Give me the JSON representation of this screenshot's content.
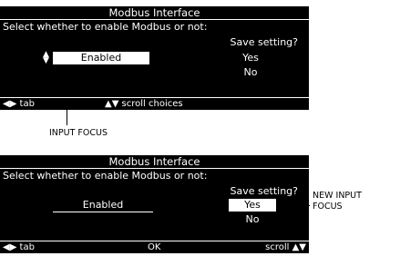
{
  "screen1": {
    "title": "Modbus Interface",
    "prompt": "Select whether to enable Modbus or not:",
    "save_question": "Save setting?",
    "selected_value": "Enabled",
    "choices": [
      "Yes",
      "No"
    ],
    "footer": {
      "left": "◀▶ tab",
      "center": "▲▼ scroll choices"
    }
  },
  "screen2": {
    "title": "Modbus Interface",
    "prompt": "Select whether to enable Modbus or not:",
    "save_question": "Save setting?",
    "field_value": "Enabled",
    "choices": [
      "Yes",
      "No"
    ],
    "footer": {
      "left": "◀▶ tab",
      "center": "OK",
      "right": "scroll ▲▼"
    }
  },
  "annotations": {
    "input_focus": "INPUT FOCUS",
    "new_input_focus_line1": "NEW INPUT",
    "new_input_focus_line2": "FOCUS"
  }
}
